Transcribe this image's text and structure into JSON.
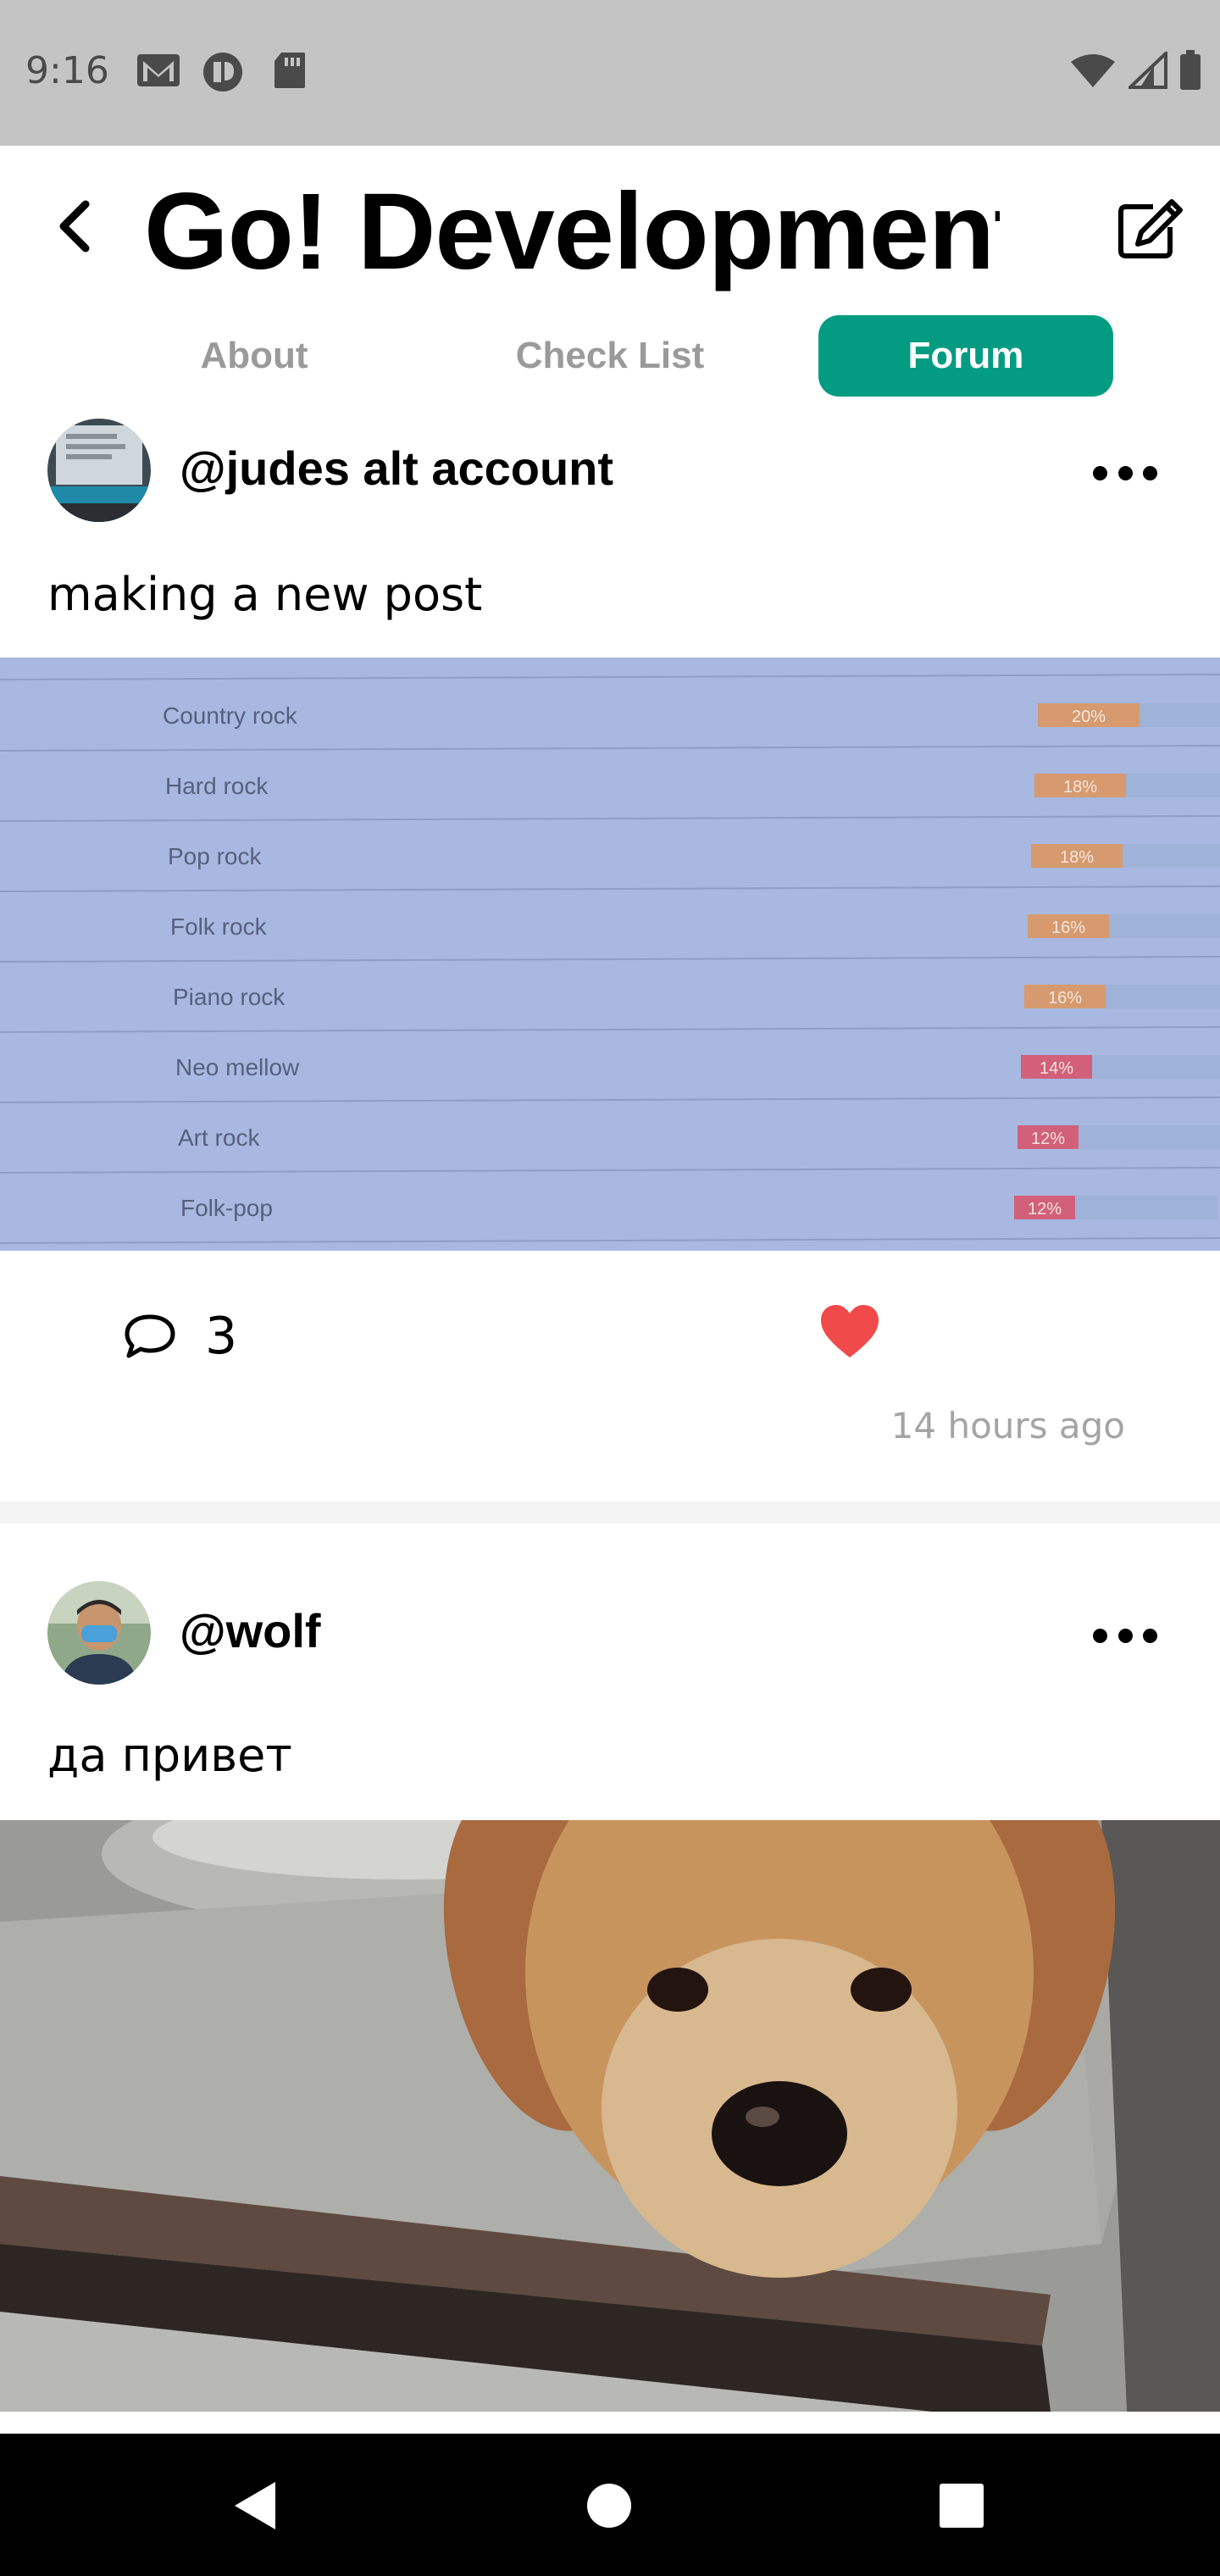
{
  "status_bar": {
    "time": "9:16",
    "icons_left": [
      "gmail-icon",
      "app-icon",
      "sd-card-icon"
    ],
    "icons_right": [
      "wifi-icon",
      "signal-icon",
      "battery-icon"
    ]
  },
  "header": {
    "title": "Go! Development",
    "back_icon": "chevron-left-icon",
    "edit_icon": "edit-icon"
  },
  "tabs": [
    {
      "label": "About",
      "active": false
    },
    {
      "label": "Check List",
      "active": false
    },
    {
      "label": "Forum",
      "active": true
    }
  ],
  "colors": {
    "accent": "#039c82",
    "like": "#f04a4a",
    "muted_text": "#9a9a9a",
    "status_bar": "#c4c4c4"
  },
  "posts": [
    {
      "username": "@judes alt account",
      "text": "making a new post",
      "image": {
        "rows": [
          {
            "label": "Country rock",
            "value": "20%"
          },
          {
            "label": "Hard rock",
            "value": "18%"
          },
          {
            "label": "Pop rock",
            "value": "18%"
          },
          {
            "label": "Folk rock",
            "value": "16%"
          },
          {
            "label": "Piano rock",
            "value": "16%"
          },
          {
            "label": "Neo mellow",
            "value": "14%"
          },
          {
            "label": "Art rock",
            "value": "12%"
          },
          {
            "label": "Folk-pop",
            "value": "12%"
          }
        ]
      },
      "comment_count": "3",
      "liked": true,
      "timestamp": "14 hours ago"
    },
    {
      "username": "@wolf",
      "text": "да привет",
      "image": {
        "subject": "dog-photo"
      }
    }
  ],
  "nav": [
    "back-nav-icon",
    "home-nav-icon",
    "recents-nav-icon"
  ]
}
